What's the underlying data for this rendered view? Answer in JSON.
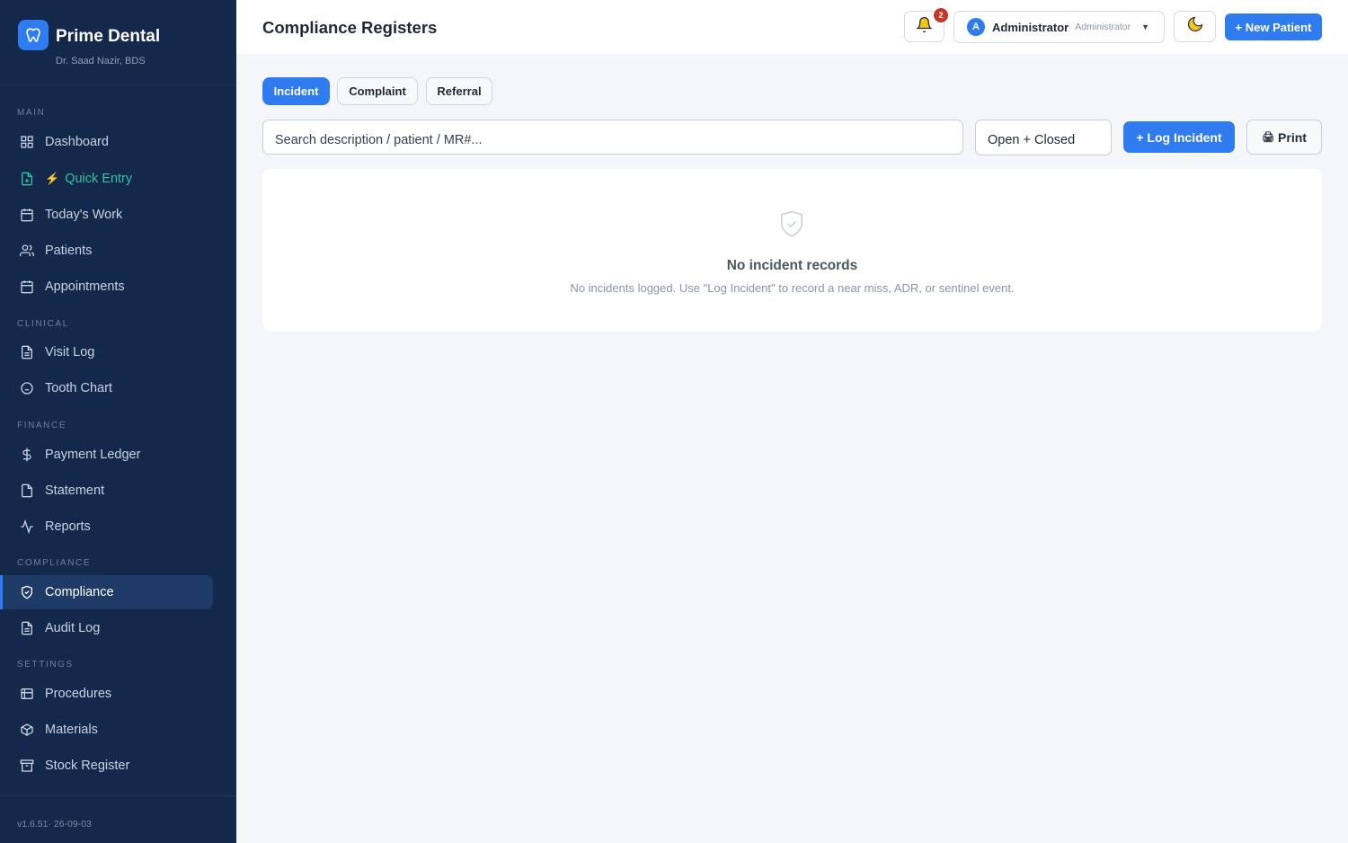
{
  "brand": {
    "name": "Prime Dental",
    "doctor": "Dr. Saad Nazir, BDS"
  },
  "sidebar": {
    "sections": [
      {
        "label": "MAIN"
      },
      {
        "label": "CLINICAL"
      },
      {
        "label": "FINANCE"
      },
      {
        "label": "COMPLIANCE"
      },
      {
        "label": "SETTINGS"
      }
    ],
    "items": [
      {
        "label": "Dashboard",
        "icon": "grid-icon"
      },
      {
        "label": "Quick Entry",
        "icon": "file-plus-icon",
        "accent": "#2ec4a4"
      },
      {
        "label": "Today's Work",
        "icon": "calendar-icon"
      },
      {
        "label": "Patients",
        "icon": "users-icon"
      },
      {
        "label": "Appointments",
        "icon": "calendar-icon"
      },
      {
        "label": "Visit Log",
        "icon": "document-icon"
      },
      {
        "label": "Tooth Chart",
        "icon": "circle-icon"
      },
      {
        "label": "Payment Ledger",
        "icon": "dollar-icon"
      },
      {
        "label": "Statement",
        "icon": "file-icon"
      },
      {
        "label": "Reports",
        "icon": "activity-icon"
      },
      {
        "label": "Compliance",
        "icon": "shield-icon",
        "active": true
      },
      {
        "label": "Audit Log",
        "icon": "document-icon"
      },
      {
        "label": "Procedures",
        "icon": "list-icon"
      },
      {
        "label": "Materials",
        "icon": "cube-icon"
      },
      {
        "label": "Stock Register",
        "icon": "archive-icon"
      }
    ],
    "version": "v1.6.51· 26-09-03"
  },
  "header": {
    "title": "Compliance Registers",
    "notifications_count": "2",
    "user_initial": "A",
    "user_name": "Administrator",
    "user_role": "Administrator",
    "new_patient_label": "+ New Patient"
  },
  "tabs": [
    {
      "label": "Incident",
      "active": true
    },
    {
      "label": "Complaint"
    },
    {
      "label": "Referral"
    }
  ],
  "toolbar": {
    "search_placeholder": "Search description / patient / MR#...",
    "filter_value": "Open + Closed",
    "log_label": "+ Log Incident",
    "print_label": "Print"
  },
  "empty": {
    "title": "No incident records",
    "subtitle": "No incidents logged. Use \"Log Incident\" to record a near miss, ADR, or sentinel event."
  },
  "colors": {
    "primary": "#2f7bf0",
    "sidebar": "#14284b",
    "accent": "#2ec4a4",
    "badge": "#c0392b"
  }
}
